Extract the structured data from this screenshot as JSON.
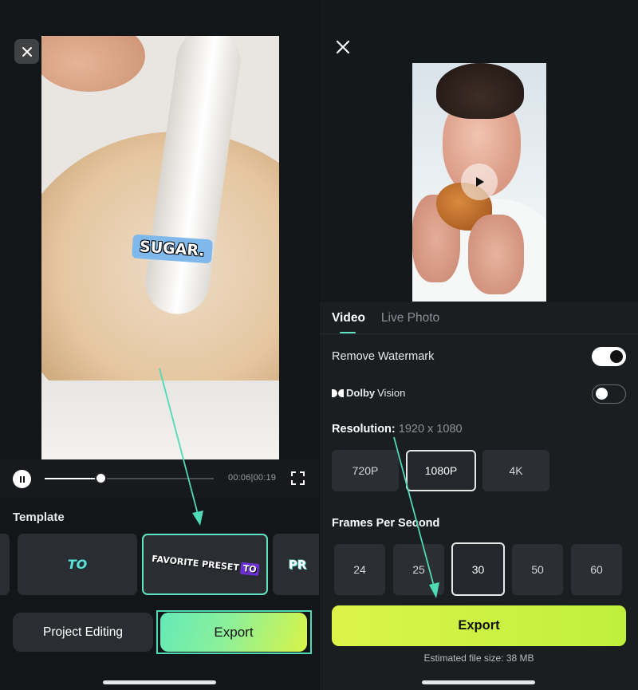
{
  "left": {
    "caption": "SUGAR.",
    "player": {
      "timecode": "00:06|00:19",
      "progress": 0.33
    },
    "template": {
      "title": "Template",
      "items": [
        {
          "label": "TO"
        },
        {
          "label": "FAVORITE PRESET",
          "tag": "TO",
          "selected": true
        },
        {
          "label": "PR"
        }
      ]
    },
    "buttons": {
      "project_editing": "Project Editing",
      "export": "Export"
    }
  },
  "right": {
    "tabs": [
      "Video",
      "Live Photo"
    ],
    "active_tab": "Video",
    "remove_watermark": {
      "label": "Remove Watermark",
      "on": true
    },
    "dolby_vision": {
      "brand": "Dolby",
      "label": "Vision",
      "on": false
    },
    "resolution": {
      "label": "Resolution:",
      "value": "1920 x 1080",
      "options": [
        "720P",
        "1080P",
        "4K"
      ],
      "selected": "1080P"
    },
    "fps": {
      "label": "Frames Per Second",
      "options": [
        "24",
        "25",
        "30",
        "50",
        "60"
      ],
      "selected": "30"
    },
    "export_label": "Export",
    "estimated_size": "Estimated file size: 38 MB"
  },
  "colors": {
    "accent": "#5fe3c0",
    "export_lime": "#d8f447",
    "arrow": "#4fd9b4"
  }
}
